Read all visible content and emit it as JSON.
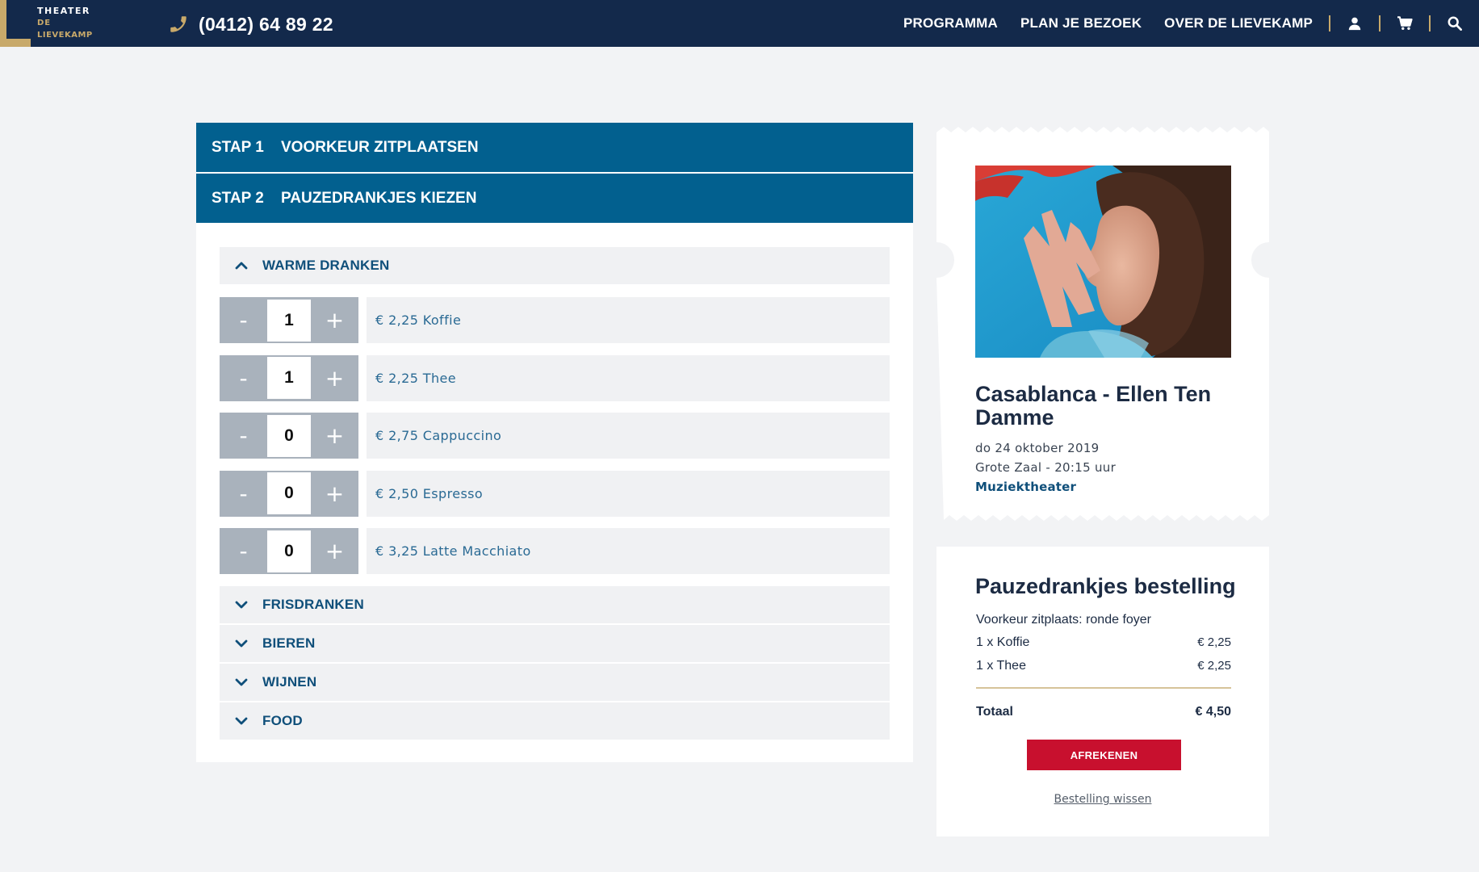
{
  "header": {
    "logo": {
      "line1": "THEATER",
      "line2": "DE",
      "line3": "LIEVEKAMP"
    },
    "phone": "(0412) 64 89 22",
    "nav": [
      "PROGRAMMA",
      "PLAN JE BEZOEK",
      "OVER DE LIEVEKAMP"
    ],
    "icons": [
      "user-icon",
      "cart-icon",
      "search-icon"
    ],
    "accent_color": "#c8a96a",
    "bar_color": "#13294b"
  },
  "steps": [
    {
      "number": "STAP 1",
      "label": "VOORKEUR ZITPLAATSEN"
    },
    {
      "number": "STAP 2",
      "label": "PAUZEDRANKJES KIEZEN"
    }
  ],
  "categories": {
    "open": {
      "label": "WARME DRANKEN",
      "items": [
        {
          "qty": "1",
          "label": "€ 2,25 Koffie"
        },
        {
          "qty": "1",
          "label": "€ 2,25 Thee"
        },
        {
          "qty": "0",
          "label": "€ 2,75 Cappuccino"
        },
        {
          "qty": "0",
          "label": "€ 2,50 Espresso"
        },
        {
          "qty": "0",
          "label": "€ 3,25 Latte Macchiato"
        }
      ]
    },
    "collapsed": [
      "FRISDRANKEN",
      "BIEREN",
      "WIJNEN",
      "FOOD"
    ]
  },
  "stepper": {
    "minus": "-",
    "plus": "+"
  },
  "ticket": {
    "title": "Casablanca - Ellen Ten Damme",
    "date": "do 24 oktober 2019",
    "venue": "Grote Zaal - 20:15 uur",
    "genre": "Muziektheater"
  },
  "order": {
    "title": "Pauzedrankjes bestelling",
    "preference": "Voorkeur zitplaats: ronde foyer",
    "lines": [
      {
        "label": "1 x Koffie",
        "price": "€ 2,25"
      },
      {
        "label": "1 x Thee",
        "price": "€ 2,25"
      }
    ],
    "total_label": "Totaal",
    "total_value": "€ 4,50",
    "checkout": "AFREKENEN",
    "clear": "Bestelling wissen"
  }
}
